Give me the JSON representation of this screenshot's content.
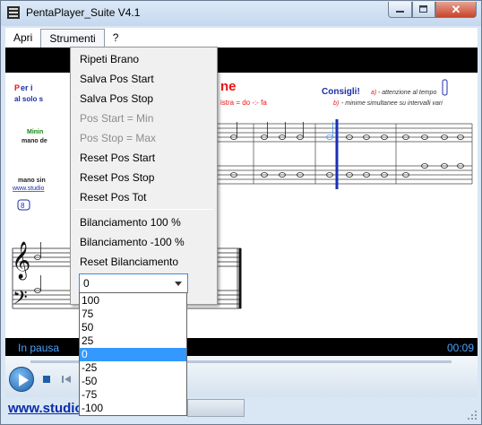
{
  "window": {
    "title": "PentaPlayer_Suite V4.1",
    "close_glyph": "✕"
  },
  "menubar": {
    "items": [
      "Apri",
      "Strumenti",
      "?"
    ]
  },
  "dropdown": {
    "items": [
      {
        "label": "Ripeti Brano",
        "enabled": true
      },
      {
        "label": "Salva Pos Start",
        "enabled": true
      },
      {
        "label": "Salva Pos Stop",
        "enabled": true
      },
      {
        "label": "Pos Start = Min",
        "enabled": false
      },
      {
        "label": "Pos Stop = Max",
        "enabled": false
      },
      {
        "label": "Reset Pos Start",
        "enabled": true
      },
      {
        "label": "Reset Pos Stop",
        "enabled": true
      },
      {
        "label": "Reset Pos Tot",
        "enabled": true
      }
    ],
    "balance_items": [
      "Bilanciamento 100 %",
      "Bilanciamento -100 %",
      "Reset Bilanciamento"
    ],
    "combo_value": "0",
    "options": [
      "100",
      "75",
      "50",
      "25",
      "0",
      "-25",
      "-50",
      "-75",
      "-100"
    ],
    "selected_option": "0"
  },
  "sheet": {
    "heading": "ne",
    "left_text_1": "P",
    "left_text_1b": "er i",
    "left_text_2": "al solo s",
    "left_text_3": "Minin",
    "left_text_4": "mano de",
    "left_text_5": "mano sin",
    "left_text_6": "www.studio",
    "formula": "istra = do -:- fa",
    "consigli_title": "Consigli!",
    "consigli_a_label": "a)",
    "consigli_a": "- attenzione al tempo",
    "consigli_b_label": "b)",
    "consigli_b": "- minime simultanee su intervalli vari",
    "measure_badge": "8"
  },
  "player": {
    "status": "In pausa",
    "time": "00:09"
  },
  "footer": {
    "link": "www.studio"
  },
  "colors": {
    "accent": "#3399ff",
    "status_text": "#4aa2ff",
    "link": "#0a2ca8",
    "heading_red": "#e11111"
  }
}
